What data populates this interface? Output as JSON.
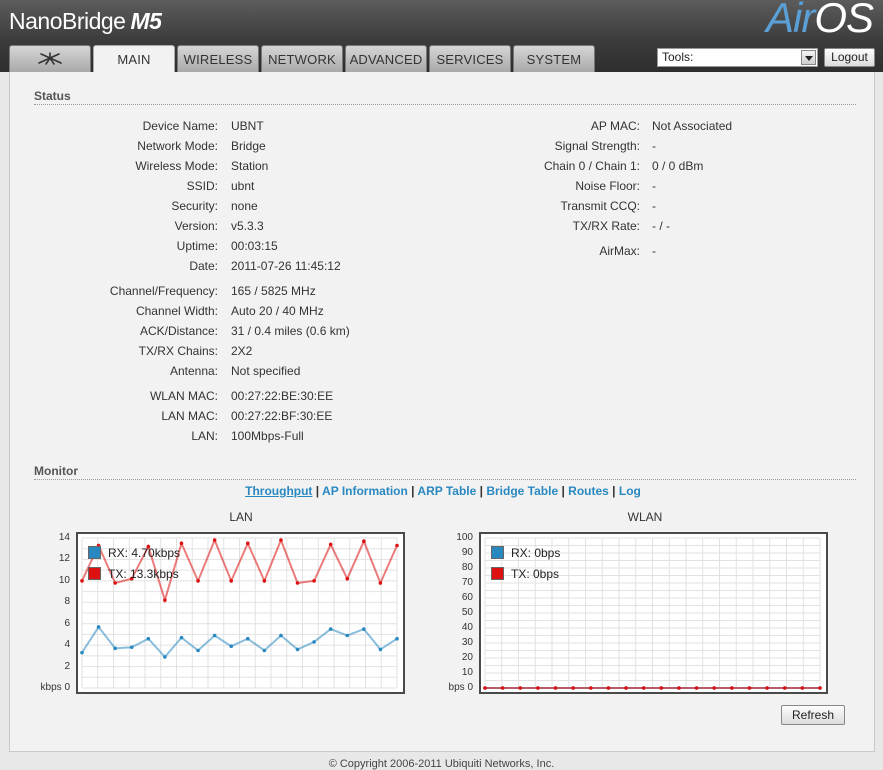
{
  "header": {
    "brand": "NanoBridge",
    "brand_model": "M5",
    "logo_air": "Air",
    "logo_os": "OS"
  },
  "tabs": [
    {
      "label": "",
      "icon": "ubiquiti-logo-icon"
    },
    {
      "label": "MAIN",
      "active": true
    },
    {
      "label": "WIRELESS"
    },
    {
      "label": "NETWORK"
    },
    {
      "label": "ADVANCED"
    },
    {
      "label": "SERVICES"
    },
    {
      "label": "SYSTEM"
    }
  ],
  "tools": {
    "selected": "Tools:"
  },
  "logout_label": "Logout",
  "status": {
    "title": "Status",
    "left": [
      {
        "label": "Device Name:",
        "value": "UBNT"
      },
      {
        "label": "Network Mode:",
        "value": "Bridge"
      },
      {
        "label": "Wireless Mode:",
        "value": "Station"
      },
      {
        "label": "SSID:",
        "value": "ubnt"
      },
      {
        "label": "Security:",
        "value": "none"
      },
      {
        "label": "Version:",
        "value": "v5.3.3"
      },
      {
        "label": "Uptime:",
        "value": "00:03:15"
      },
      {
        "label": "Date:",
        "value": "2011-07-26 11:45:12"
      },
      {
        "label": "Channel/Frequency:",
        "value": "165 / 5825 MHz"
      },
      {
        "label": "Channel Width:",
        "value": "Auto 20 / 40 MHz"
      },
      {
        "label": "ACK/Distance:",
        "value": "31 / 0.4 miles (0.6 km)"
      },
      {
        "label": "TX/RX Chains:",
        "value": "2X2"
      },
      {
        "label": "Antenna:",
        "value": "Not specified"
      },
      {
        "label": "WLAN MAC:",
        "value": "00:27:22:BE:30:EE"
      },
      {
        "label": "LAN MAC:",
        "value": "00:27:22:BF:30:EE"
      },
      {
        "label": "LAN:",
        "value": "100Mbps-Full"
      }
    ],
    "right": [
      {
        "label": "AP MAC:",
        "value": "Not Associated"
      },
      {
        "label": "Signal Strength:",
        "value": "-"
      },
      {
        "label": "Chain 0 / Chain 1:",
        "value": "0 / 0 dBm"
      },
      {
        "label": "Noise Floor:",
        "value": "-"
      },
      {
        "label": "Transmit CCQ:",
        "value": "-"
      },
      {
        "label": "TX/RX Rate:",
        "value": "- / -"
      },
      {
        "label": "AirMax:",
        "value": "-"
      }
    ]
  },
  "monitor": {
    "title": "Monitor",
    "links": [
      "Throughput",
      "AP Information",
      "ARP Table",
      "Bridge Table",
      "Routes",
      "Log"
    ],
    "active_link": "Throughput",
    "separator": " | "
  },
  "chart_data": [
    {
      "type": "line",
      "title": "LAN",
      "ylabel": "kbps",
      "ylim": [
        0,
        14
      ],
      "yticks": [
        0,
        2,
        4,
        6,
        8,
        10,
        12,
        14
      ],
      "grid": true,
      "series": [
        {
          "name": "RX: 4.70kbps",
          "color": "#2a88c0",
          "values": [
            3.3,
            5.7,
            3.7,
            3.8,
            4.6,
            2.9,
            4.7,
            3.5,
            4.9,
            3.9,
            4.6,
            3.5,
            4.9,
            3.6,
            4.3,
            5.5,
            4.9,
            5.5,
            3.6,
            4.6
          ]
        },
        {
          "name": "TX: 13.3kbps",
          "color": "#dd1111",
          "values": [
            10.0,
            13.3,
            9.8,
            10.2,
            13.2,
            8.2,
            13.5,
            10.0,
            13.8,
            10.0,
            13.5,
            10.0,
            13.8,
            9.8,
            10.0,
            13.4,
            10.2,
            13.7,
            9.8,
            13.3
          ]
        }
      ]
    },
    {
      "type": "line",
      "title": "WLAN",
      "ylabel": "bps",
      "ylim": [
        0,
        100
      ],
      "yticks": [
        0,
        10,
        20,
        30,
        40,
        50,
        60,
        70,
        80,
        90,
        100
      ],
      "grid": true,
      "series": [
        {
          "name": "RX: 0bps",
          "color": "#2a88c0",
          "values": [
            0,
            0,
            0,
            0,
            0,
            0,
            0,
            0,
            0,
            0,
            0,
            0,
            0,
            0,
            0,
            0,
            0,
            0,
            0,
            0
          ]
        },
        {
          "name": "TX: 0bps",
          "color": "#dd1111",
          "values": [
            0,
            0,
            0,
            0,
            0,
            0,
            0,
            0,
            0,
            0,
            0,
            0,
            0,
            0,
            0,
            0,
            0,
            0,
            0,
            0
          ]
        }
      ]
    }
  ],
  "refresh_label": "Refresh",
  "footer": "© Copyright 2006-2011 Ubiquiti Networks, Inc."
}
